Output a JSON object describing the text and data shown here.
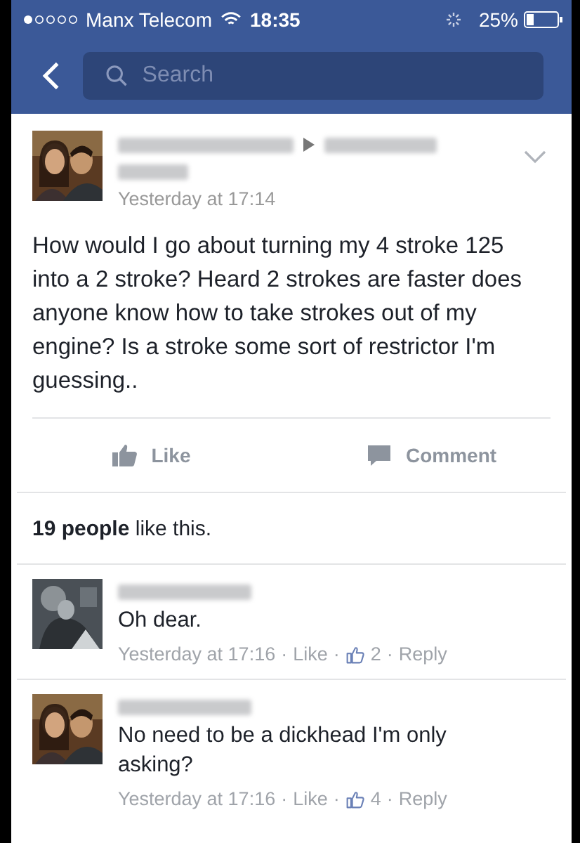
{
  "status_bar": {
    "carrier": "Manx Telecom",
    "time": "18:35",
    "battery": "25%"
  },
  "nav": {
    "search": {
      "placeholder": "Search"
    }
  },
  "post": {
    "time": "Yesterday at 17:14",
    "text": "How would I go about turning my 4 stroke 125 into a 2 stroke? Heard 2 strokes are faster does anyone know how to take strokes out of my engine? Is a stroke some sort of restrictor I'm guessing..",
    "actions": [
      {
        "kind": "like",
        "label": "Like"
      },
      {
        "kind": "comment",
        "label": "Comment"
      }
    ],
    "likes_summary": "**19 people** like this."
  },
  "comments": [
    {
      "text": "Oh dear.",
      "meta": [
        {
          "kind": "time",
          "text": "Yesterday at 17:16"
        },
        {
          "kind": "sep",
          "text": "·"
        },
        {
          "kind": "link",
          "text": "Like"
        },
        {
          "kind": "sep",
          "text": "·"
        },
        {
          "kind": "count",
          "text": "2"
        },
        {
          "kind": "sep",
          "text": "·"
        },
        {
          "kind": "link",
          "text": "Reply"
        }
      ]
    },
    {
      "text": "No need to be a dickhead I'm only asking?",
      "meta": [
        {
          "kind": "time",
          "text": "Yesterday at 17:16"
        },
        {
          "kind": "sep",
          "text": "·"
        },
        {
          "kind": "link",
          "text": "Like"
        },
        {
          "kind": "sep",
          "text": "·"
        },
        {
          "kind": "count",
          "text": "4"
        },
        {
          "kind": "sep",
          "text": "·"
        },
        {
          "kind": "link",
          "text": "Reply"
        }
      ]
    }
  ]
}
